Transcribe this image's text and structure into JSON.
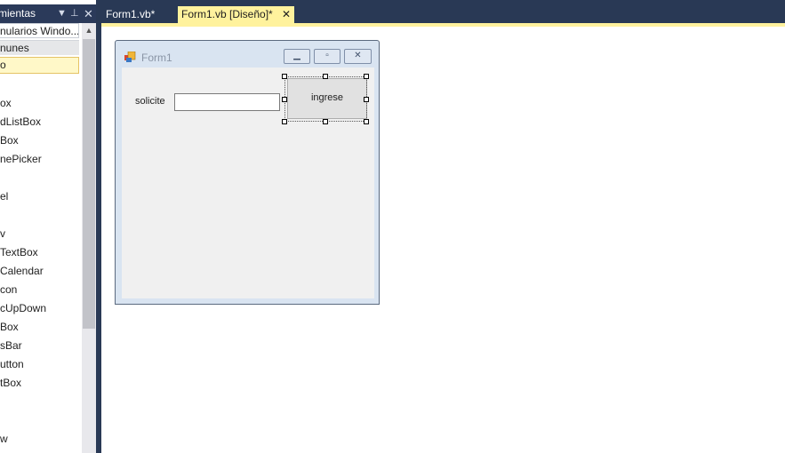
{
  "toolbox": {
    "title": "mientas",
    "categories": [
      "nularios Windo...",
      "nunes",
      "o"
    ],
    "items": [
      "ox",
      "dListBox",
      "Box",
      "nePicker",
      "el",
      "v",
      "TextBox",
      "Calendar",
      "con",
      "cUpDown",
      "Box",
      "sBar",
      "utton",
      "tBox",
      "w"
    ]
  },
  "tabs": {
    "tab1": "Form1.vb*",
    "tab2": "Form1.vb [Diseño]*"
  },
  "form": {
    "title": "Form1",
    "label_text": "solicite",
    "textbox_value": "",
    "button_label": "ingrese"
  }
}
